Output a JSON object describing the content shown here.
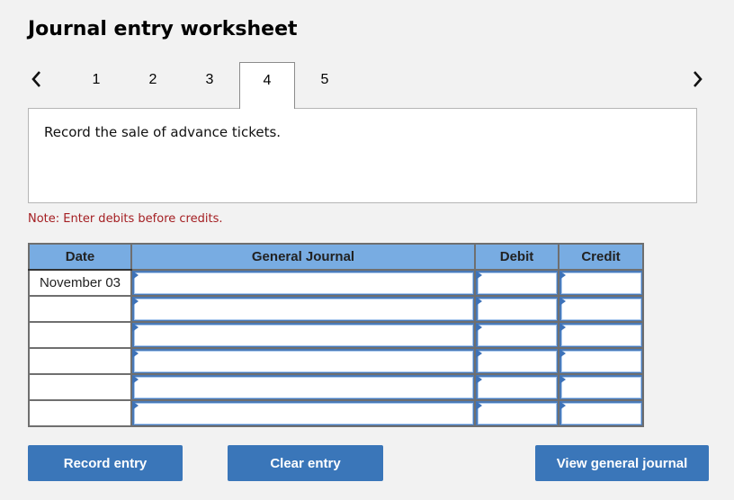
{
  "header": {
    "title": "Journal entry worksheet"
  },
  "pagination": {
    "prev_icon": "chevron-left-icon",
    "next_icon": "chevron-right-icon",
    "tabs": [
      {
        "label": "1",
        "active": false
      },
      {
        "label": "2",
        "active": false
      },
      {
        "label": "3",
        "active": false
      },
      {
        "label": "4",
        "active": true
      },
      {
        "label": "5",
        "active": false
      }
    ]
  },
  "prompt": {
    "text": "Record the sale of advance tickets."
  },
  "note": {
    "text": "Note: Enter debits before credits."
  },
  "journal": {
    "columns": [
      "Date",
      "General Journal",
      "Debit",
      "Credit"
    ],
    "rows": [
      {
        "date": "November 03",
        "account": "",
        "debit": "",
        "credit": ""
      },
      {
        "date": "",
        "account": "",
        "debit": "",
        "credit": ""
      },
      {
        "date": "",
        "account": "",
        "debit": "",
        "credit": ""
      },
      {
        "date": "",
        "account": "",
        "debit": "",
        "credit": ""
      },
      {
        "date": "",
        "account": "",
        "debit": "",
        "credit": ""
      },
      {
        "date": "",
        "account": "",
        "debit": "",
        "credit": ""
      }
    ]
  },
  "buttons": {
    "record": "Record entry",
    "clear": "Clear entry",
    "view": "View general journal"
  },
  "colors": {
    "header_bg": "#78ace2",
    "button_bg": "#3a76b9",
    "note_text": "#a41e22",
    "input_border": "#4a7ab8"
  }
}
